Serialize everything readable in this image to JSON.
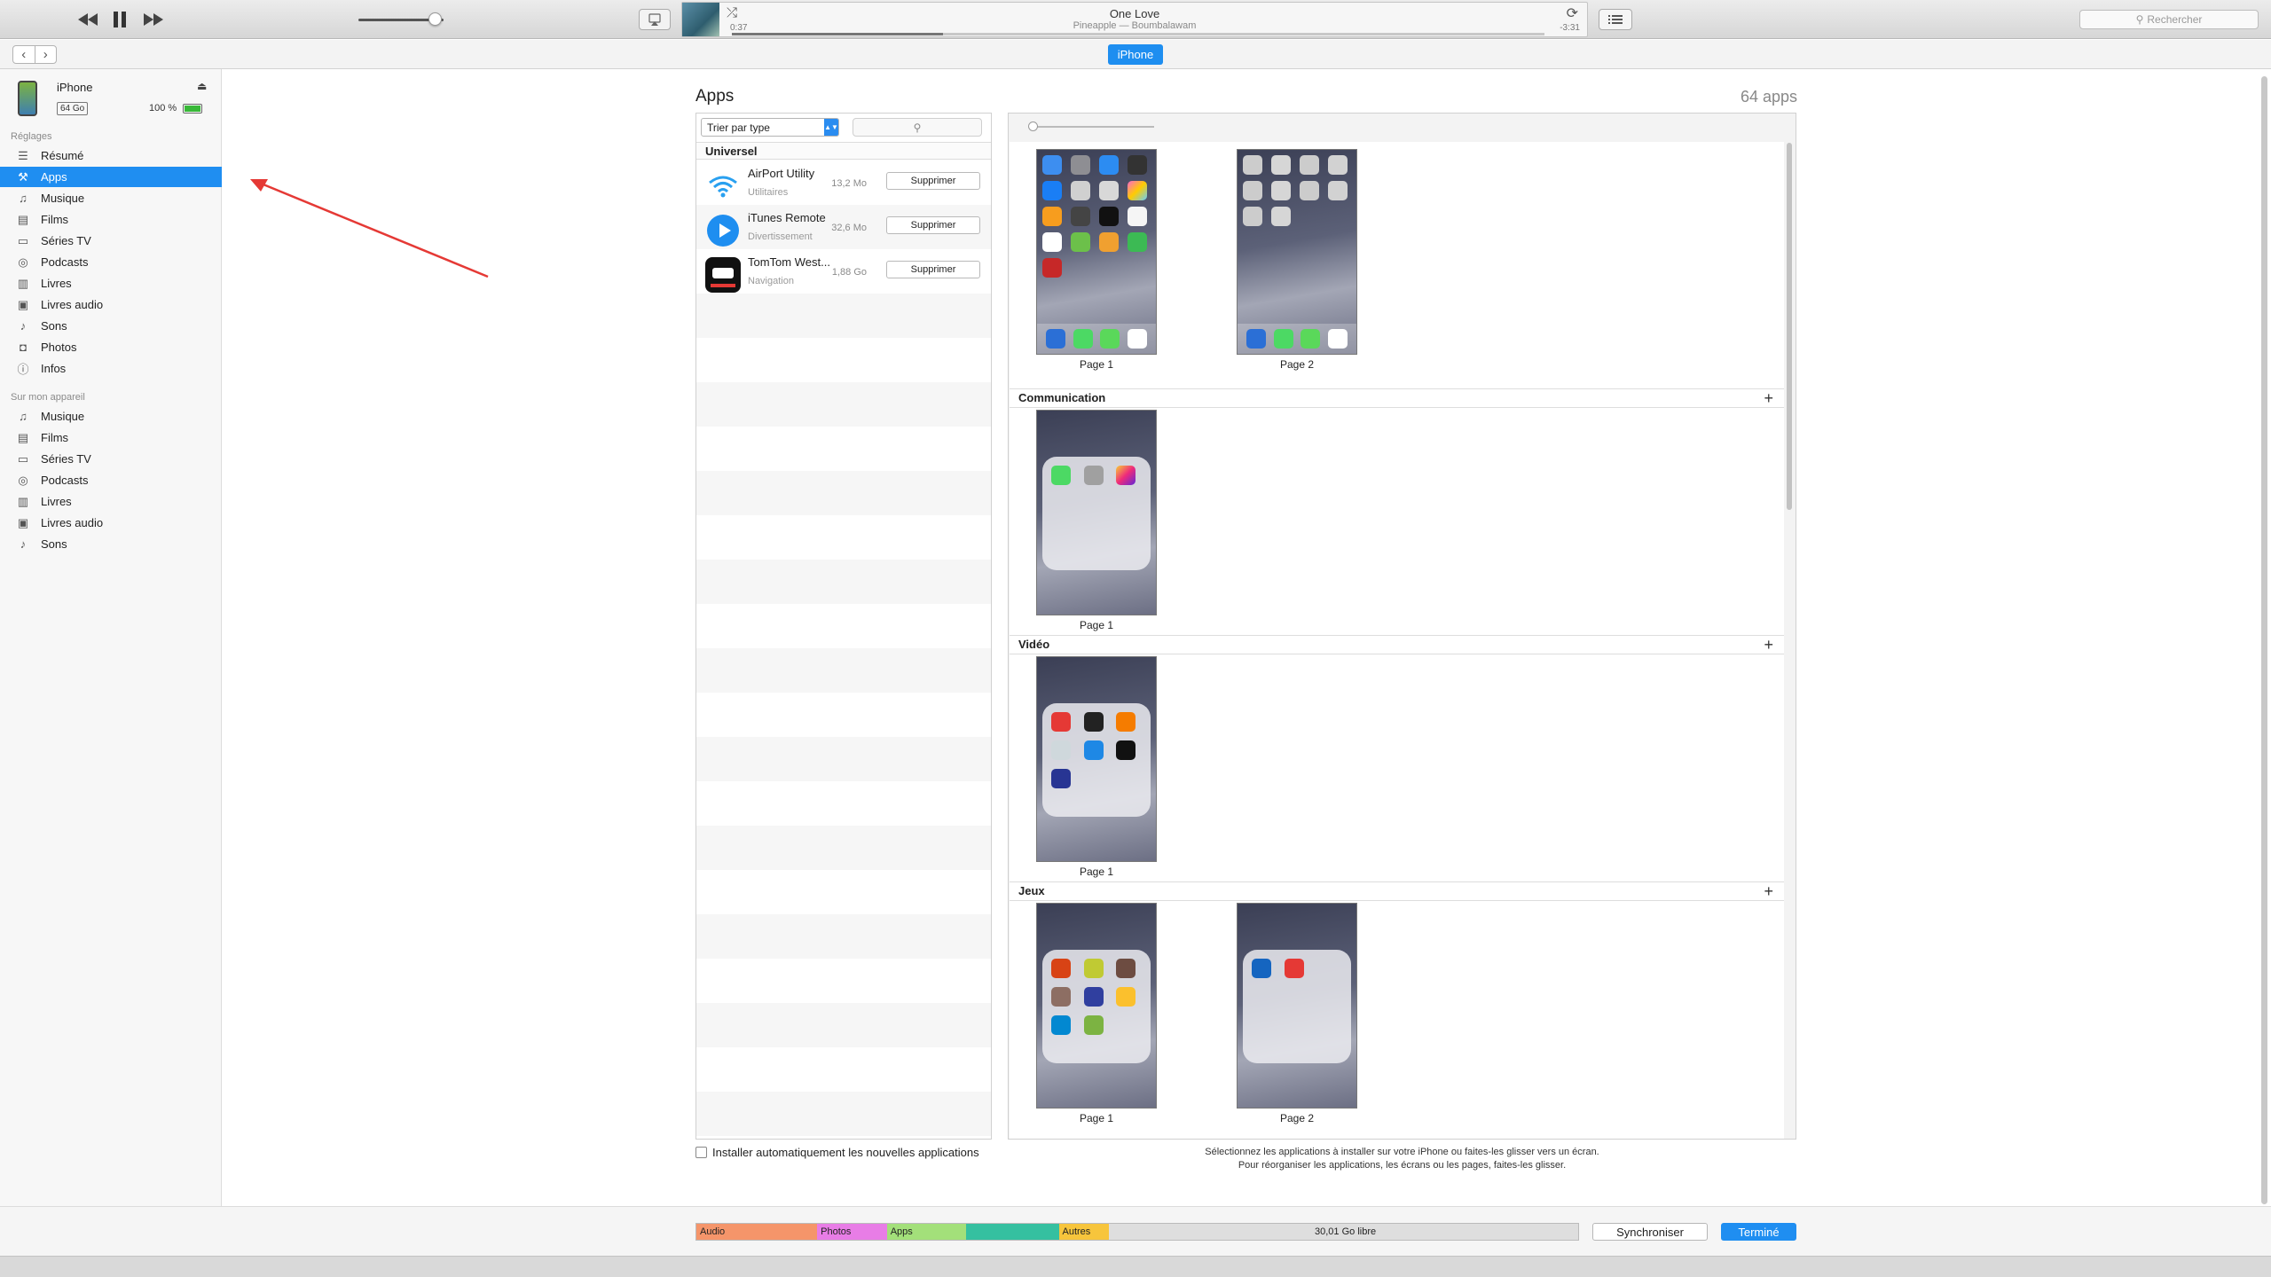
{
  "toolbar": {
    "now_playing": {
      "title": "One Love",
      "subtitle": "Pineapple — Boumbalawam",
      "elapsed": "0:37",
      "remaining": "-3:31",
      "progress": 0.26
    },
    "volume": 0.9,
    "search_placeholder": "Rechercher"
  },
  "nav": {
    "device_tab": "iPhone"
  },
  "device": {
    "name": "iPhone",
    "capacity": "64 Go",
    "battery": "100 %"
  },
  "sidebar": {
    "settings_head": "Réglages",
    "settings_items": [
      {
        "label": "Résumé",
        "icon": "summary-icon",
        "glyph": "☰"
      },
      {
        "label": "Apps",
        "icon": "apps-icon",
        "glyph": "⚒",
        "active": true
      },
      {
        "label": "Musique",
        "icon": "music-icon",
        "glyph": "♫"
      },
      {
        "label": "Films",
        "icon": "film-icon",
        "glyph": "▤"
      },
      {
        "label": "Séries TV",
        "icon": "tv-icon",
        "glyph": "▭"
      },
      {
        "label": "Podcasts",
        "icon": "podcast-icon",
        "glyph": "◎"
      },
      {
        "label": "Livres",
        "icon": "book-icon",
        "glyph": "▥"
      },
      {
        "label": "Livres audio",
        "icon": "audiobook-icon",
        "glyph": "▣"
      },
      {
        "label": "Sons",
        "icon": "bell-icon",
        "glyph": "♪"
      },
      {
        "label": "Photos",
        "icon": "camera-icon",
        "glyph": "◘"
      },
      {
        "label": "Infos",
        "icon": "info-icon",
        "glyph": "ⓘ"
      }
    ],
    "device_head": "Sur mon appareil",
    "device_items": [
      {
        "label": "Musique",
        "icon": "music-icon",
        "glyph": "♫"
      },
      {
        "label": "Films",
        "icon": "film-icon",
        "glyph": "▤"
      },
      {
        "label": "Séries TV",
        "icon": "tv-icon",
        "glyph": "▭"
      },
      {
        "label": "Podcasts",
        "icon": "podcast-icon",
        "glyph": "◎"
      },
      {
        "label": "Livres",
        "icon": "book-icon",
        "glyph": "▥"
      },
      {
        "label": "Livres audio",
        "icon": "audiobook-icon",
        "glyph": "▣"
      },
      {
        "label": "Sons",
        "icon": "bell-icon",
        "glyph": "♪"
      }
    ]
  },
  "main": {
    "title": "Apps",
    "count": "64 apps",
    "sort_label": "Trier par type",
    "section_universal": "Universel",
    "apps": [
      {
        "name": "AirPort Utility",
        "category": "Utilitaires",
        "size": "13,2 Mo",
        "delete_label": "Supprimer",
        "icon": "wifi-icon"
      },
      {
        "name": "iTunes Remote",
        "category": "Divertissement",
        "size": "32,6 Mo",
        "delete_label": "Supprimer",
        "icon": "play-icon"
      },
      {
        "name": "TomTom West...",
        "category": "Navigation",
        "size": "1,88 Go",
        "delete_label": "Supprimer",
        "icon": "tomtom-icon"
      }
    ],
    "auto_install_label": "Installer automatiquement les nouvelles applications",
    "pages": {
      "p1": "Page 1",
      "p2": "Page 2"
    },
    "categories": {
      "communication": "Communication",
      "video": "Vidéo",
      "games": "Jeux"
    },
    "hint_line1": "Sélectionnez les applications à installer sur votre iPhone ou faites-les glisser vers un écran.",
    "hint_line2": "Pour réorganiser les applications, les écrans ou les pages, faites-les glisser."
  },
  "storage": {
    "segments": [
      {
        "label": "Audio",
        "color": "#f5956a",
        "fraction": 0.137
      },
      {
        "label": "Photos",
        "color": "#e87de6",
        "fraction": 0.079
      },
      {
        "label": "Apps",
        "color": "#a3e07a",
        "fraction": 0.09
      },
      {
        "label": "",
        "color": "#35c0a0",
        "fraction": 0.105
      },
      {
        "label": "Autres",
        "color": "#f7c53c",
        "fraction": 0.057
      }
    ],
    "free_label": "30,01 Go libre"
  },
  "buttons": {
    "sync": "Synchroniser",
    "done": "Terminé"
  },
  "colors": {
    "accent": "#1f8ef1",
    "arrow": "#e53935"
  }
}
